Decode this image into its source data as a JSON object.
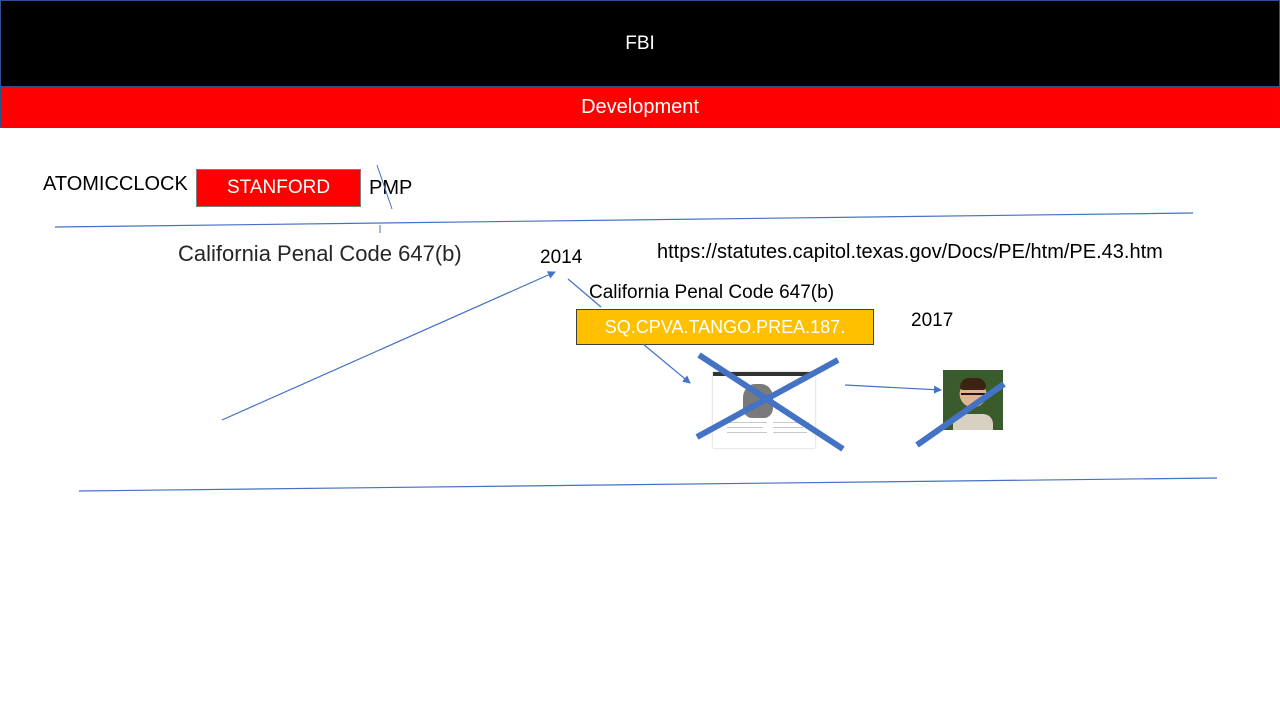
{
  "header": {
    "title": "FBI"
  },
  "subheader": {
    "title": "Development"
  },
  "labels": {
    "atomicclock": "ATOMICCLOCK",
    "stanford": "STANFORD",
    "pmp": "PMP",
    "penal_code_1": "California Penal Code 647(b)",
    "year_2014": "2014",
    "url": "https://statutes.capitol.texas.gov/Docs/PE/htm/PE.43.htm",
    "penal_code_2": "California Penal Code 647(b)",
    "tango": "SQ.CPVA.TANGO.PREA.187.",
    "year_2017": "2017"
  },
  "colors": {
    "header_bg": "#000000",
    "subheader_bg": "#ff0000",
    "stanford_box": "#ff0000",
    "tango_box": "#ffc000",
    "connector": "#4472c4"
  }
}
